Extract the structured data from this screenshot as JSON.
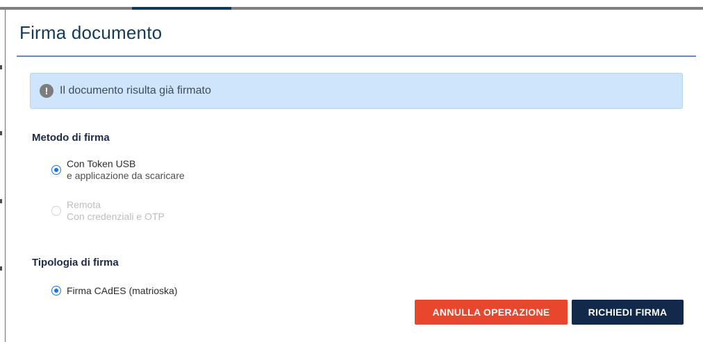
{
  "dialog": {
    "title": "Firma documento",
    "alert": {
      "icon": "exclamation-circle-icon",
      "text": "Il documento risulta già firmato"
    },
    "signing_method": {
      "label": "Metodo di firma",
      "options": [
        {
          "title": "Con Token USB",
          "subtitle": "e applicazione da scaricare",
          "checked": true,
          "disabled": false
        },
        {
          "title": "Remota",
          "subtitle": "Con credenziali e OTP",
          "checked": false,
          "disabled": true
        }
      ]
    },
    "signature_type": {
      "label": "Tipologia di firma",
      "options": [
        {
          "title": "Firma CAdES (matrioska)",
          "checked": true
        }
      ]
    },
    "buttons": {
      "cancel": "ANNULLA OPERAZIONE",
      "submit": "RICHIEDI FIRMA"
    }
  },
  "colors": {
    "title": "#123a5a",
    "alert_bg": "#cfe5fb",
    "radio_accent": "#1a73e8",
    "cancel_button": "#e8472d",
    "submit_button": "#13294b"
  }
}
